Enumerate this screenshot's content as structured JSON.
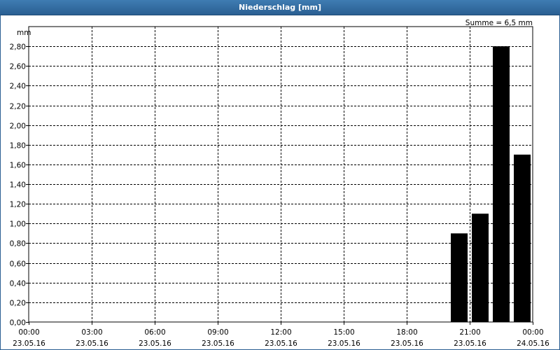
{
  "window": {
    "title": "Niederschlag [mm]"
  },
  "chart_data": {
    "type": "bar",
    "title": "Niederschlag [mm]",
    "ylabel": "mm",
    "annotation": "Summe = 6,5 mm",
    "ylim": [
      0,
      3.0
    ],
    "yticks": [
      "0,00",
      "0,20",
      "0,40",
      "0,60",
      "0,80",
      "1,00",
      "1,20",
      "1,40",
      "1,60",
      "1,80",
      "2,00",
      "2,20",
      "2,40",
      "2,60",
      "2,80"
    ],
    "ytick_values": [
      0,
      0.2,
      0.4,
      0.6,
      0.8,
      1.0,
      1.2,
      1.4,
      1.6,
      1.8,
      2.0,
      2.2,
      2.4,
      2.6,
      2.8
    ],
    "xlim_hours": [
      0,
      24
    ],
    "xticks": [
      {
        "time": "00:00",
        "date": "23.05.16",
        "hour": 0
      },
      {
        "time": "03:00",
        "date": "23.05.16",
        "hour": 3
      },
      {
        "time": "06:00",
        "date": "23.05.16",
        "hour": 6
      },
      {
        "time": "09:00",
        "date": "23.05.16",
        "hour": 9
      },
      {
        "time": "12:00",
        "date": "23.05.16",
        "hour": 12
      },
      {
        "time": "15:00",
        "date": "23.05.16",
        "hour": 15
      },
      {
        "time": "18:00",
        "date": "23.05.16",
        "hour": 18
      },
      {
        "time": "21:00",
        "date": "23.05.16",
        "hour": 21
      },
      {
        "time": "00:00",
        "date": "24.05.16",
        "hour": 24
      }
    ],
    "bars": [
      {
        "hour_start": 20,
        "hour_end": 21,
        "value": 0.9
      },
      {
        "hour_start": 21,
        "hour_end": 22,
        "value": 1.1
      },
      {
        "hour_start": 22,
        "hour_end": 23,
        "value": 2.8
      },
      {
        "hour_start": 23,
        "hour_end": 24,
        "value": 1.7
      }
    ],
    "grid": true,
    "colors": {
      "bar": "#000000",
      "titlebar": "#2a5f92"
    }
  }
}
